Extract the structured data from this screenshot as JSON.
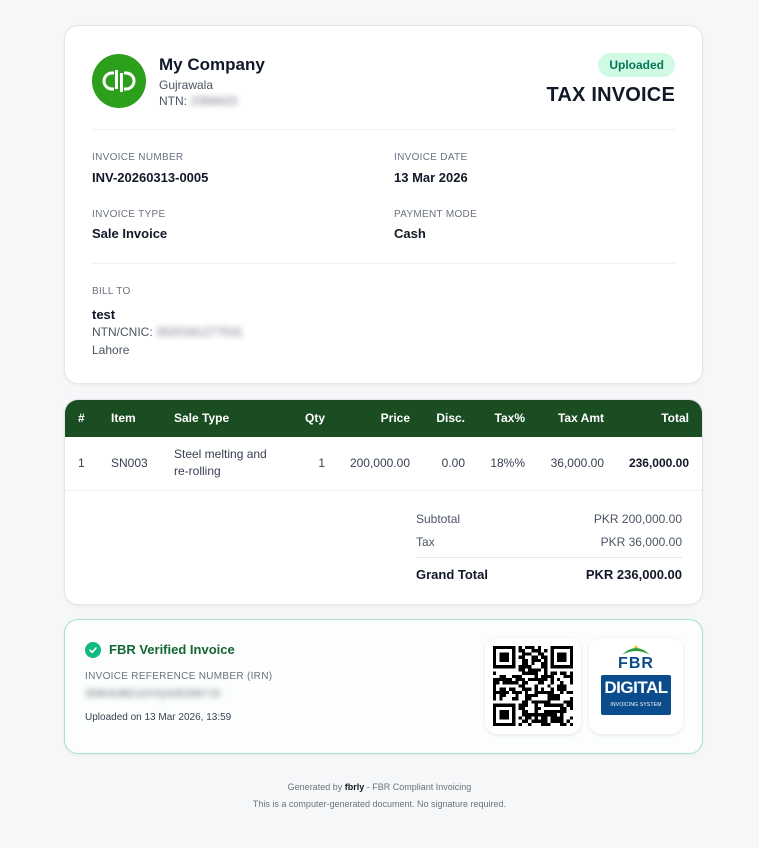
{
  "company": {
    "name": "My Company",
    "city": "Gujrawala",
    "ntn_label": "NTN:",
    "ntn_value": "2358423"
  },
  "status": "Uploaded",
  "document_title": "TAX INVOICE",
  "invoice": {
    "number_label": "INVOICE NUMBER",
    "number": "INV-20260313-0005",
    "date_label": "INVOICE DATE",
    "date": "13 Mar 2026",
    "type_label": "INVOICE TYPE",
    "type": "Sale Invoice",
    "payment_label": "PAYMENT MODE",
    "payment": "Cash"
  },
  "bill_to": {
    "label": "BILL TO",
    "name": "test",
    "ntn_label": "NTN/CNIC:",
    "ntn_value": "3520181277531",
    "city": "Lahore"
  },
  "table": {
    "headers": [
      "#",
      "Item",
      "Sale Type",
      "Qty",
      "Price",
      "Disc.",
      "Tax%",
      "Tax Amt",
      "Total"
    ],
    "rows": [
      {
        "num": "1",
        "item": "SN003",
        "sale_type_1": "Steel melting and",
        "sale_type_2": "re-rolling",
        "qty": "1",
        "price": "200,000.00",
        "disc": "0.00",
        "tax_pct": "18%%",
        "tax_amt": "36,000.00",
        "total": "236,000.00"
      }
    ]
  },
  "summary": {
    "subtotal_label": "Subtotal",
    "subtotal": "PKR 200,000.00",
    "tax_label": "Tax",
    "tax": "PKR 36,000.00",
    "grand_label": "Grand Total",
    "grand": "PKR 236,000.00"
  },
  "verification": {
    "title": "FBR Verified Invoice",
    "irn_label": "INVOICE REFERENCE NUMBER (IRN)",
    "irn_value": "3580438D1DVQ4353997J3",
    "uploaded_on": "Uploaded on 13 Mar 2026, 13:59",
    "fbr_logo_word": "FBR",
    "fbr_logo_digital": "DIGITAL",
    "fbr_logo_sub": "INVOICING SYSTEM"
  },
  "footer": {
    "generated_prefix": "Generated by",
    "brand": "fbrly",
    "generated_suffix": "- FBR Compliant Invoicing",
    "note": "This is a computer-generated document. No signature required."
  },
  "colors": {
    "table_header": "#1b4d23",
    "status_bg": "#d1fae5",
    "status_text": "#047857",
    "logo_green": "#2ca01c",
    "fbr_blue": "#0b4c8c"
  },
  "icons": {
    "logo": "quickbooks-logo",
    "verified": "check-circle-icon",
    "qr": "qr-code-icon"
  }
}
